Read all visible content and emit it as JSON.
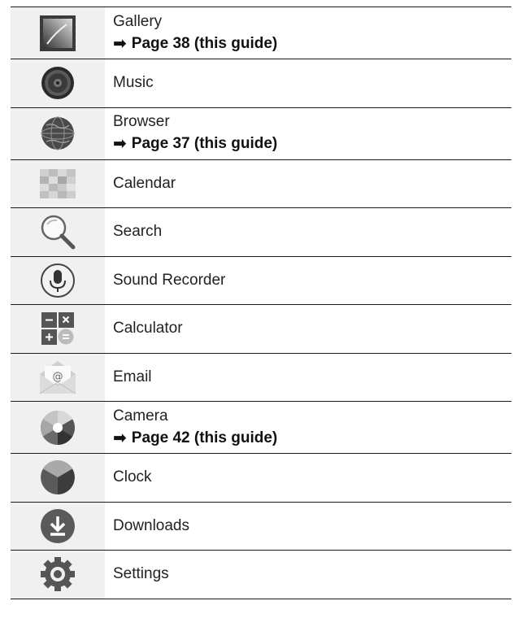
{
  "arrow_glyph": "➡",
  "apps": [
    {
      "name": "Gallery",
      "icon": "gallery-icon",
      "ref": "Page 38 (this guide)"
    },
    {
      "name": "Music",
      "icon": "music-icon"
    },
    {
      "name": "Browser",
      "icon": "browser-icon",
      "ref": "Page 37 (this guide)"
    },
    {
      "name": "Calendar",
      "icon": "calendar-icon"
    },
    {
      "name": "Search",
      "icon": "search-icon"
    },
    {
      "name": "Sound Recorder",
      "icon": "microphone-icon"
    },
    {
      "name": "Calculator",
      "icon": "calculator-icon"
    },
    {
      "name": "Email",
      "icon": "email-icon"
    },
    {
      "name": "Camera",
      "icon": "camera-icon",
      "ref": "Page 42 (this guide)"
    },
    {
      "name": "Clock",
      "icon": "clock-icon"
    },
    {
      "name": "Downloads",
      "icon": "download-icon"
    },
    {
      "name": "Settings",
      "icon": "gear-icon"
    }
  ],
  "colors": {
    "rule": "#1a1a1a",
    "icon_column_bg": "#f0f0f0",
    "text": "#222222"
  }
}
